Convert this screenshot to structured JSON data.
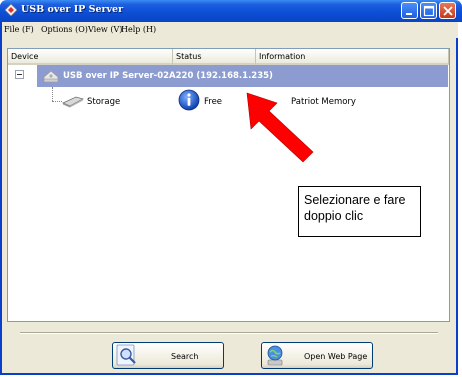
{
  "window": {
    "title": "USB over IP Server",
    "accent": "#0c4fd6"
  },
  "titlebar_buttons": [
    {
      "name": "minimize",
      "icon": "minimize-icon"
    },
    {
      "name": "maximize",
      "icon": "maximize-icon"
    },
    {
      "name": "close",
      "icon": "close-icon"
    }
  ],
  "menu": {
    "file": "File (F)",
    "options": "Options (O)",
    "view": "View (V)",
    "help": "Help (H)"
  },
  "columns": {
    "device": "Device",
    "status": "Status",
    "information": "Information"
  },
  "tree": {
    "server": {
      "label": "USB over IP Server-02A220  (192.168.1.235)",
      "icon": "server-icon",
      "selected_color": "#8c9cd0",
      "expanded": true
    },
    "devices": [
      {
        "name": "Storage",
        "icon": "storage-icon",
        "status": "Free",
        "status_icon": "info-icon",
        "information": "Patriot Memory"
      }
    ]
  },
  "annotation": {
    "callout_text": "Selezionare e fare doppio clic",
    "arrow_color": "#ff0000"
  },
  "buttons": {
    "search": "Search",
    "open_web_page": "Open Web Page"
  }
}
